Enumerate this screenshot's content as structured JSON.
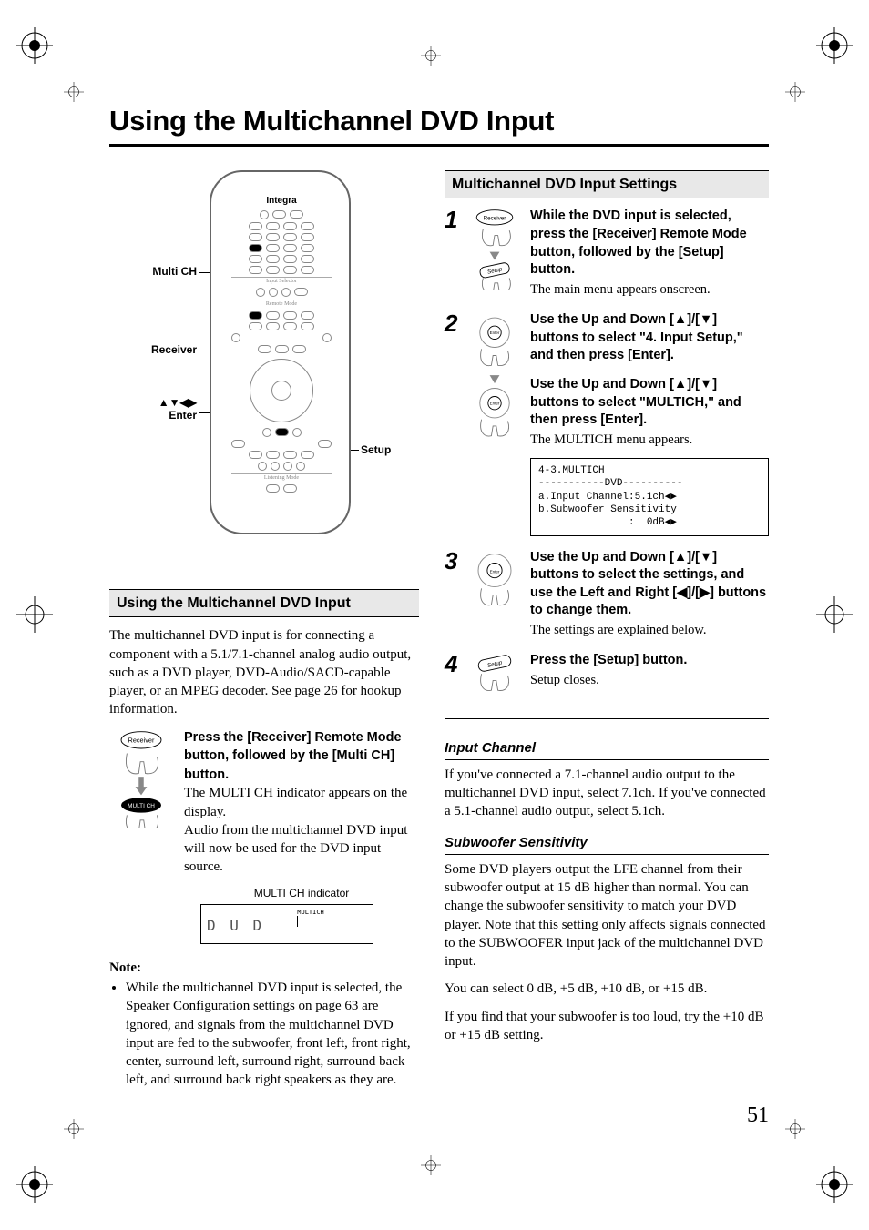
{
  "page_number": "51",
  "title": "Using the Multichannel DVD Input",
  "remote": {
    "brand": "Integra",
    "callouts": {
      "multi_ch": "Multi CH",
      "receiver": "Receiver",
      "dpad_enter": "▲▼◀▶\nEnter",
      "setup": "Setup"
    }
  },
  "left": {
    "subhead": "Using the Multichannel DVD Input",
    "intro": "The multichannel DVD input is for connecting a component with a 5.1/7.1-channel analog audio output, such as a DVD player, DVD-Audio/SACD-capable player, or an MPEG decoder. See page 26 for hookup information.",
    "instr_bold": "Press the [Receiver] Remote Mode button, followed by the [Multi CH] button.",
    "instr_body1": "The MULTI CH indicator appears on the display.",
    "instr_body2": "Audio from the multichannel DVD input will now be used for the DVD input source.",
    "indicator_label": "MULTI CH indicator",
    "lcd_main": "D U D",
    "lcd_tag": "MULTICH",
    "note_head": "Note:",
    "note_item": "While the multichannel DVD input is selected, the Speaker Configuration settings on page 63 are ignored, and signals from the multichannel DVD input are fed to the subwoofer, front left, front right, center, surround left, surround right, surround back left, and surround back right speakers as they are."
  },
  "right": {
    "subhead": "Multichannel DVD Input Settings",
    "steps": [
      {
        "num": "1",
        "bold": "While the DVD input is selected, press the [Receiver] Remote Mode button, followed by the [Setup] button.",
        "body": "The main menu appears onscreen."
      },
      {
        "num": "2",
        "bold_a": "Use the Up and Down [▲]/[▼] buttons to select \"4. Input Setup,\" and then press [Enter].",
        "bold_b": "Use the Up and Down [▲]/[▼] buttons to select \"MULTICH,\" and then press [Enter].",
        "body": "The MULTICH menu appears.",
        "menu": "4-3.MULTICH\n-----------DVD----------\na.Input Channel:5.1ch◀▶\nb.Subwoofer Sensitivity\n               :  0dB◀▶"
      },
      {
        "num": "3",
        "bold": "Use the Up and Down [▲]/[▼] buttons to select the settings, and use the Left and Right [◀]/[▶] buttons to change them.",
        "body": "The settings are explained below."
      },
      {
        "num": "4",
        "bold": "Press the [Setup] button.",
        "body": "Setup closes."
      }
    ],
    "input_channel": {
      "head": "Input Channel",
      "body": "If you've connected a 7.1-channel audio output to the multichannel DVD input, select 7.1ch. If you've connected a 5.1-channel audio output, select 5.1ch."
    },
    "sub_sens": {
      "head": "Subwoofer Sensitivity",
      "body1": "Some DVD players output the LFE channel from their subwoofer output at 15 dB higher than normal. You can change the subwoofer sensitivity to match your DVD player. Note that this setting only affects signals connected to the SUBWOOFER input jack of the multichannel DVD input.",
      "body2": "You can select 0 dB, +5 dB, +10 dB, or +15 dB.",
      "body3": "If you find that your subwoofer is too loud, try the +10 dB or +15 dB setting."
    },
    "thumb_labels": {
      "receiver": "Receiver",
      "setup": "Setup",
      "enter": "Enter",
      "multi_ch": "MULTI CH"
    }
  }
}
